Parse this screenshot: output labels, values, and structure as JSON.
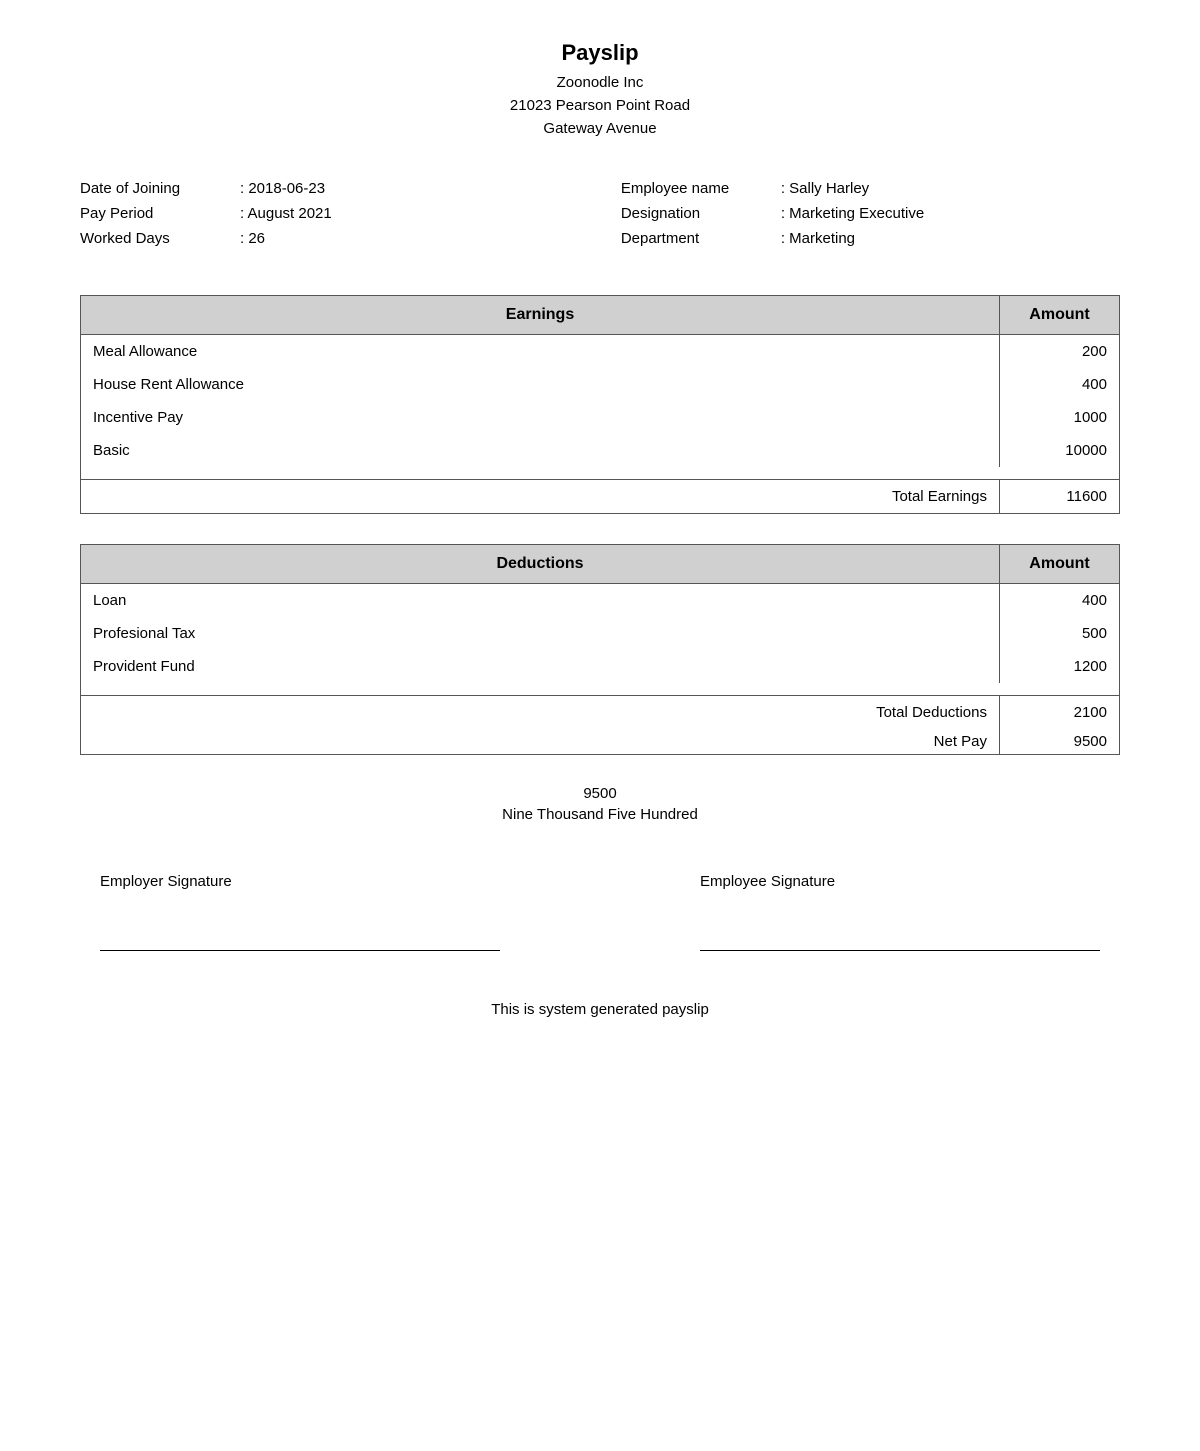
{
  "header": {
    "title": "Payslip",
    "company_name": "Zoonodle Inc",
    "address_line1": "21023 Pearson Point Road",
    "address_line2": "Gateway Avenue"
  },
  "employee_info": {
    "left": {
      "date_of_joining_label": "Date of Joining",
      "date_of_joining_value": ": 2018-06-23",
      "pay_period_label": "Pay Period",
      "pay_period_value": ": August 2021",
      "worked_days_label": "Worked Days",
      "worked_days_value": ": 26"
    },
    "right": {
      "employee_name_label": "Employee name",
      "employee_name_value": ": Sally Harley",
      "designation_label": "Designation",
      "designation_value": ": Marketing Executive",
      "department_label": "Department",
      "department_value": ": Marketing"
    }
  },
  "earnings_table": {
    "header_earnings": "Earnings",
    "header_amount": "Amount",
    "rows": [
      {
        "label": "Basic",
        "amount": "10000"
      },
      {
        "label": "Incentive Pay",
        "amount": "1000"
      },
      {
        "label": "House Rent Allowance",
        "amount": "400"
      },
      {
        "label": "Meal Allowance",
        "amount": "200"
      }
    ],
    "total_label": "Total Earnings",
    "total_amount": "11600"
  },
  "deductions_table": {
    "header_deductions": "Deductions",
    "header_amount": "Amount",
    "rows": [
      {
        "label": "Provident Fund",
        "amount": "1200"
      },
      {
        "label": "Profesional Tax",
        "amount": "500"
      },
      {
        "label": "Loan",
        "amount": "400"
      }
    ],
    "total_label": "Total Deductions",
    "total_amount": "2100",
    "net_pay_label": "Net Pay",
    "net_pay_amount": "9500"
  },
  "net_amount": {
    "number": "9500",
    "words": "Nine Thousand Five Hundred"
  },
  "signatures": {
    "employer_label": "Employer Signature",
    "employee_label": "Employee Signature"
  },
  "footer": {
    "text": "This is system generated payslip"
  }
}
